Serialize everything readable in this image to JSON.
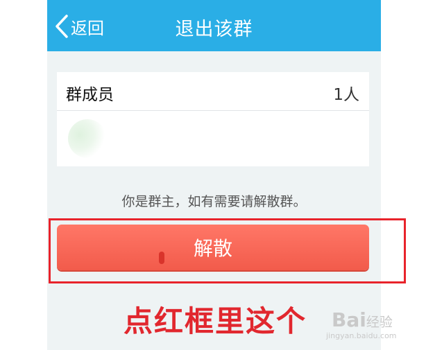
{
  "header": {
    "back_label": "返回",
    "title": "退出该群"
  },
  "members": {
    "label": "群成员",
    "count": "1人"
  },
  "notice": "你是群主，如有需要请解散群。",
  "disband_button": "解散",
  "annotation": {
    "caption": "点红框里这个"
  },
  "watermark": {
    "logo": "Bai",
    "text": "经验",
    "url": "jingyan.baidu.com"
  },
  "colors": {
    "header_blue": "#2aaee6",
    "button_red": "#f25b4b",
    "annotation_red": "#e8232b",
    "page_bg": "#eef3f4"
  }
}
